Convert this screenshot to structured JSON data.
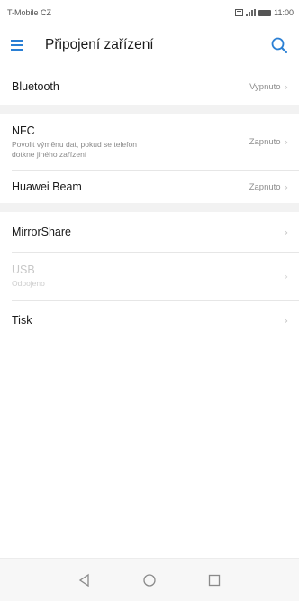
{
  "status_bar": {
    "carrier": "T-Mobile CZ",
    "time": "11:00"
  },
  "app_bar": {
    "title": "Připojení zařízení",
    "menu_icon": "hamburger-menu-icon",
    "search_icon": "search-icon",
    "accent_color": "#2a7fd4"
  },
  "items": [
    {
      "title": "Bluetooth",
      "value": "Vypnuto",
      "subtitle": ""
    },
    {
      "title": "NFC",
      "value": "Zapnuto",
      "subtitle": "Povolit výměnu dat, pokud se telefon dotkne jiného zařízení"
    },
    {
      "title": "Huawei Beam",
      "value": "Zapnuto",
      "subtitle": ""
    },
    {
      "title": "MirrorShare",
      "value": "",
      "subtitle": ""
    },
    {
      "title": "USB",
      "value": "",
      "subtitle": "Odpojeno",
      "disabled": true
    },
    {
      "title": "Tisk",
      "value": "",
      "subtitle": ""
    }
  ],
  "nav_bar": {
    "back_icon": "back-triangle-icon",
    "home_icon": "home-circle-icon",
    "recents_icon": "recents-square-icon"
  }
}
